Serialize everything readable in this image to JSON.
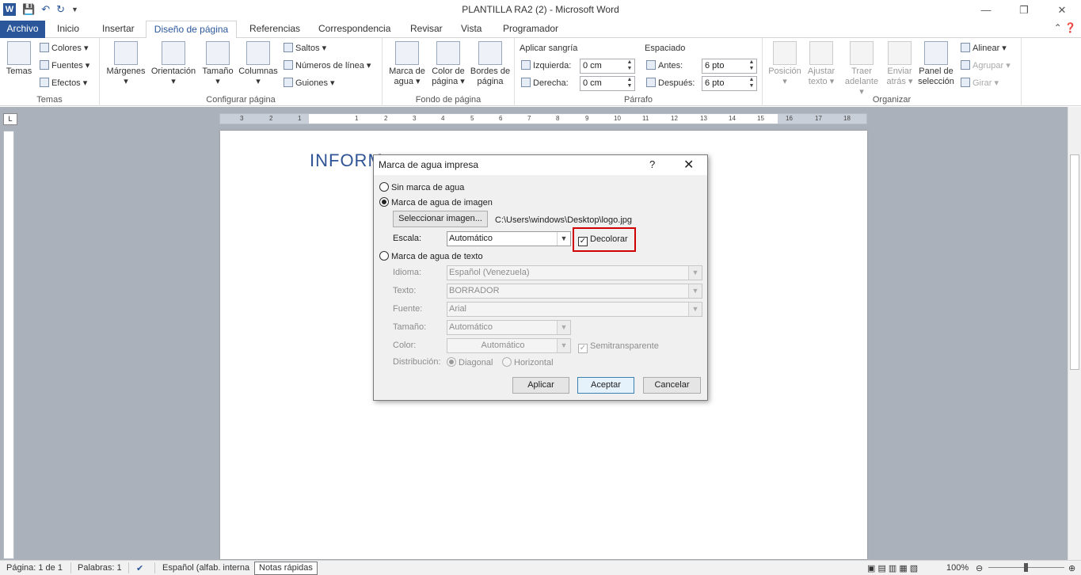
{
  "window": {
    "title": "PLANTILLA RA2 (2)  -  Microsoft Word",
    "app_icon": "W",
    "qat": [
      "save-icon",
      "undo-icon",
      "redo-icon",
      "customize-icon"
    ],
    "controls": [
      "minimize-icon",
      "restore-icon",
      "close-icon"
    ]
  },
  "tabs": {
    "file": "Archivo",
    "items": [
      "Inicio",
      "Insertar",
      "Diseño de página",
      "Referencias",
      "Correspondencia",
      "Revisar",
      "Vista",
      "Programador"
    ],
    "active": "Diseño de página"
  },
  "ribbon": {
    "temas": {
      "label": "Temas",
      "big": "Temas",
      "colores": "Colores",
      "fuentes": "Fuentes",
      "efectos": "Efectos"
    },
    "configurar": {
      "label": "Configurar página",
      "margenes": "Márgenes",
      "orientacion": "Orientación",
      "tamano": "Tamaño",
      "columnas": "Columnas",
      "saltos": "Saltos",
      "numeros": "Números de línea",
      "guiones": "Guiones"
    },
    "fondo": {
      "label": "Fondo de página",
      "marca_1": "Marca de",
      "marca_2": "agua",
      "color_1": "Color de",
      "color_2": "página",
      "bordes_1": "Bordes de",
      "bordes_2": "página"
    },
    "parrafo": {
      "label": "Párrafo",
      "sangria": "Aplicar sangría",
      "izquierda": "Izquierda:",
      "derecha": "Derecha:",
      "izq_val": "0 cm",
      "der_val": "0 cm",
      "espaciado": "Espaciado",
      "antes": "Antes:",
      "despues": "Después:",
      "antes_val": "6 pto",
      "despues_val": "6 pto"
    },
    "organizar": {
      "label": "Organizar",
      "posicion": "Posición",
      "ajustar_1": "Ajustar",
      "ajustar_2": "texto",
      "traer_1": "Traer",
      "traer_2": "adelante",
      "enviar_1": "Enviar",
      "enviar_2": "atrás",
      "panel_1": "Panel de",
      "panel_2": "selección",
      "alinear": "Alinear",
      "agrupar": "Agrupar",
      "girar": "Girar"
    }
  },
  "ruler": {
    "ticks": [
      "3",
      "2",
      "1",
      "",
      "1",
      "2",
      "3",
      "4",
      "5",
      "6",
      "7",
      "8",
      "9",
      "10",
      "11",
      "12",
      "13",
      "14",
      "15",
      "16",
      "17",
      "18"
    ]
  },
  "document": {
    "heading": "INFORM"
  },
  "dialog": {
    "title": "Marca de agua impresa",
    "help": "?",
    "close": "✕",
    "sin_marca": "Sin marca de agua",
    "imagen": "Marca de agua de imagen",
    "seleccionar": "Seleccionar imagen...",
    "ruta": "C:\\Users\\windows\\Desktop\\logo.jpg",
    "escala_label": "Escala:",
    "escala_val": "Automático",
    "decolorar": "Decolorar",
    "texto_option": "Marca de agua de texto",
    "idioma_label": "Idioma:",
    "idioma_val": "Español (Venezuela)",
    "texto_label": "Texto:",
    "texto_val": "BORRADOR",
    "fuente_label": "Fuente:",
    "fuente_val": "Arial",
    "tamano_label": "Tamaño:",
    "tamano_val": "Automático",
    "color_label": "Color:",
    "color_val": "Automático",
    "semitransparente": "Semitransparente",
    "distribucion_label": "Distribución:",
    "diagonal": "Diagonal",
    "horizontal": "Horizontal",
    "aplicar": "Aplicar",
    "aceptar": "Aceptar",
    "cancelar": "Cancelar",
    "selected_mode": "imagen",
    "decolorar_checked": true
  },
  "statusbar": {
    "pagina": "Página: 1 de 1",
    "palabras": "Palabras: 1",
    "idioma": "Español (alfab. interna",
    "tooltip": "Notas rápidas",
    "zoom": "100%",
    "zoom_percent": 100
  },
  "colors": {
    "accent": "#2b579a",
    "highlight": "#d10000"
  }
}
